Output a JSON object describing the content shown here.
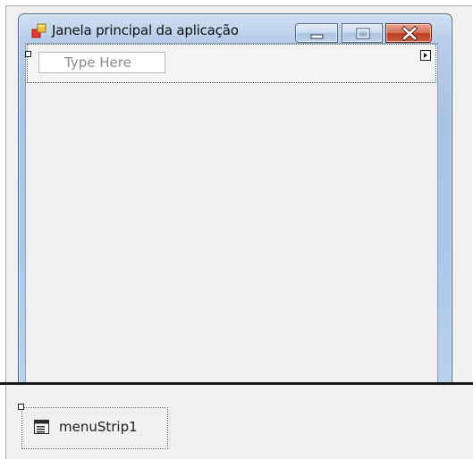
{
  "form": {
    "title": "Janela principal da aplicação",
    "menu_placeholder": "Type Here",
    "app_icon": "windows-forms-app-icon",
    "controls": [
      "minimize-icon",
      "maximize-icon",
      "close-icon"
    ]
  },
  "component_tray": {
    "components": [
      {
        "label": "menuStrip1",
        "icon": "menustrip-component-icon"
      }
    ]
  },
  "colors": {
    "close_button": "#c94a2e",
    "window_frame": "#b7cde9",
    "design_surface": "#f0f0f0"
  }
}
